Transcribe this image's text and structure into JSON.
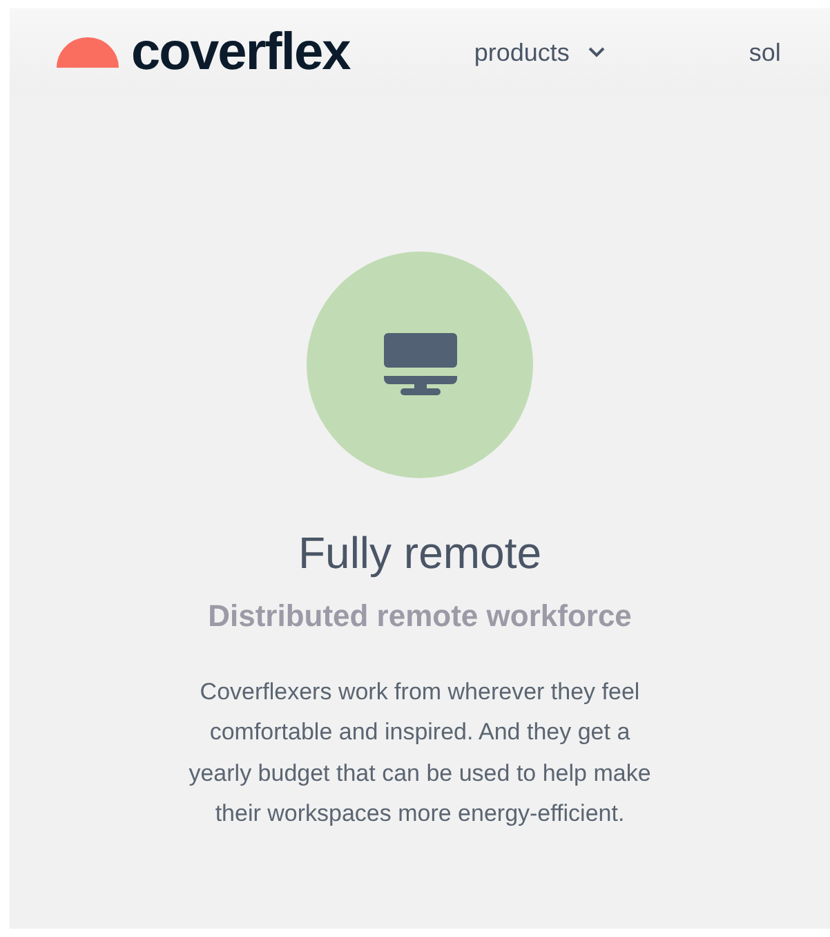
{
  "header": {
    "logo": "coverflex",
    "nav": [
      {
        "label": "products",
        "has_dropdown": true
      },
      {
        "label": "sol",
        "has_dropdown": false
      }
    ]
  },
  "feature": {
    "title": "Fully remote",
    "subtitle": "Distributed remote workforce",
    "description": "Coverflexers work from wherever they feel comfortable and inspired. And they get a yearly budget that can be used to help make their workspaces more energy-efficient."
  }
}
